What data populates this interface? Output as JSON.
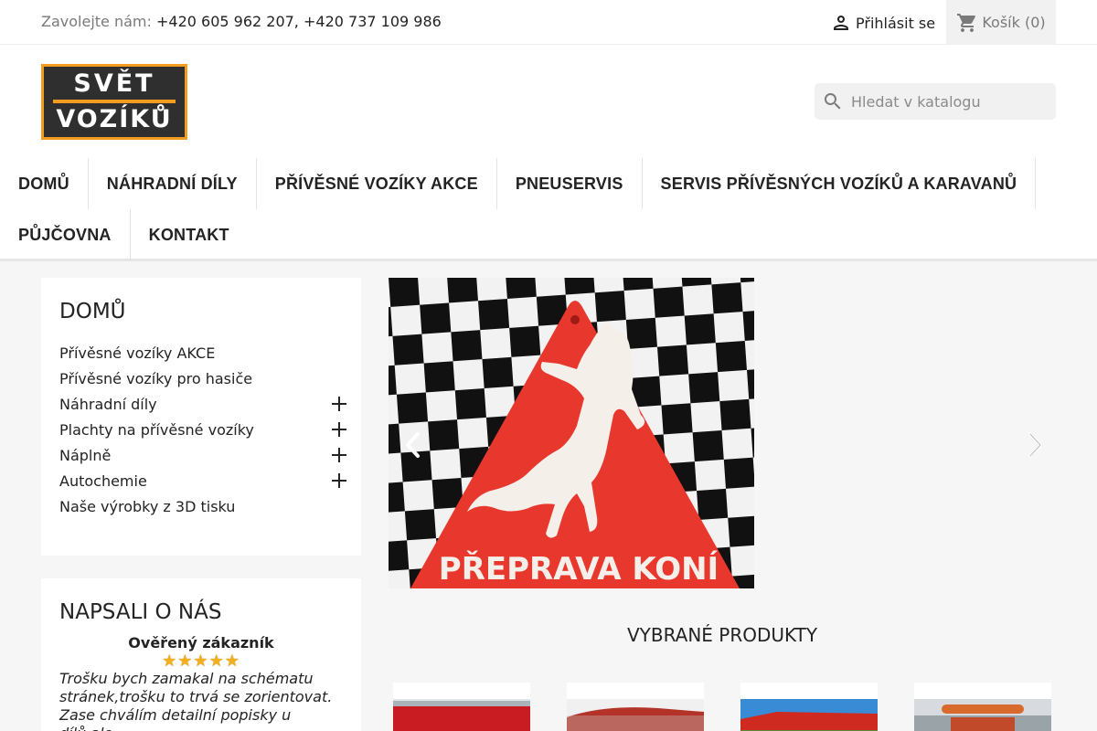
{
  "topbar": {
    "contact_label": "Zavolejte nám:",
    "phones": "+420 605 962 207, +420 737 109 986",
    "signin_label": "Přihlásit se",
    "cart_label": "Košík",
    "cart_count": "(0)"
  },
  "header": {
    "logo_line1": "SVĚT",
    "logo_line2": "VOZÍKŮ",
    "search_placeholder": "Hledat v katalogu"
  },
  "menu": {
    "items": [
      "DOMŮ",
      "NÁHRADNÍ DÍLY",
      "PŘÍVĚSNÉ VOZÍKY AKCE",
      "PNEUSERVIS",
      "SERVIS PŘÍVĚSNÝCH VOZÍKŮ A KARAVANŮ",
      "PŮJČOVNA",
      "KONTAKT"
    ]
  },
  "categories": {
    "title": "DOMŮ",
    "items": [
      {
        "label": "Přívěsné vozíky AKCE"
      },
      {
        "label": "Přívěsné vozíky pro hasiče"
      },
      {
        "label": "Náhradní díly"
      },
      {
        "label": "Plachty na přívěsné vozíky"
      },
      {
        "label": "Náplně"
      },
      {
        "label": "Autochemie"
      },
      {
        "label": "Naše výrobky z 3D tisku"
      }
    ]
  },
  "reviews": {
    "title": "NAPSALI O NÁS",
    "verified_label": "Ověřený zákazník",
    "rating": 5,
    "text": "Trošku bych zamakal na schématu stránek,trošku to trvá se zorientovat. Zase chválím detailní popisky u dílů,ale"
  },
  "slider": {
    "slide_text": "PŘEPRAVA KONÍ",
    "colors": {
      "sign": "#e8382e",
      "horse": "#f4efe9"
    }
  },
  "featured": {
    "title": "VYBRANÉ PRODUKTY"
  },
  "colors": {
    "accent": "#f39c1f",
    "text": "#232323",
    "muted": "#7a7a7a"
  }
}
